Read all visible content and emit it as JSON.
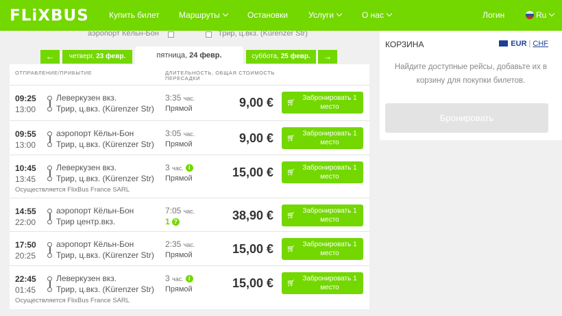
{
  "header": {
    "logo": "FLiXBUS",
    "nav": [
      "Купить билет",
      "Маршруты",
      "Остановки",
      "Услуги",
      "О нас"
    ],
    "login": "Логин",
    "language": "Ru"
  },
  "stations_strip": [
    "аэропорт Кёльн-Бон",
    "Трир, ц.вкз. (Kürenzer Str)"
  ],
  "dates": {
    "prev_label": "четверг,",
    "prev_date": "23 февр.",
    "active_label": "пятница,",
    "active_date": "24 февр.",
    "next_label": "суббота,",
    "next_date": "25 февр.",
    "prev_arrow": "←",
    "next_arrow": "→"
  },
  "columns": {
    "departure": "ОТПРАВЛЕНИЕ/ПРИБЫТИЕ",
    "duration": "ДЛИТЕЛЬНОСТЬ, ОБЩАЯ СТОИМОСТЬ",
    "duration2": "ПЕРЕСАДКИ"
  },
  "rides": [
    {
      "dep": "09:25",
      "arr": "13:00",
      "from": "Леверкузен вкз.",
      "to": "Трир, ц.вкз. (Kürenzer Str)",
      "dur": "3:35",
      "unit": "час.",
      "transfer": "Прямой",
      "price": "9,00 €",
      "button": "Забронировать 1 место",
      "info": false,
      "operator": ""
    },
    {
      "dep": "09:55",
      "arr": "13:00",
      "from": "аэропорт Кёльн-Бон",
      "to": "Трир, ц.вкз. (Kürenzer Str)",
      "dur": "3:05",
      "unit": "час.",
      "transfer": "Прямой",
      "price": "9,00 €",
      "button": "Забронировать 1 место",
      "info": false,
      "operator": ""
    },
    {
      "dep": "10:45",
      "arr": "13:45",
      "from": "Леверкузен вкз.",
      "to": "Трир, ц.вкз. (Kürenzer Str)",
      "dur": "3",
      "unit": "час.",
      "transfer": "Прямой",
      "price": "15,00 €",
      "button": "Забронировать 1 место",
      "info": true,
      "operator": "Осуществляется FlixBus France SARL"
    },
    {
      "dep": "14:55",
      "arr": "22:00",
      "from": "аэропорт Кёльн-Бон",
      "to": "Трир центр.вкз.",
      "dur": "7:05",
      "unit": "час.",
      "transfer": "1",
      "price": "38,90 €",
      "button": "Забронировать 1 место",
      "info": false,
      "operator": ""
    },
    {
      "dep": "17:50",
      "arr": "20:25",
      "from": "аэропорт Кёльн-Бон",
      "to": "Трир, ц.вкз. (Kürenzer Str)",
      "dur": "2:35",
      "unit": "час.",
      "transfer": "Прямой",
      "price": "15,00 €",
      "button": "Забронировать 1 место",
      "info": false,
      "operator": ""
    },
    {
      "dep": "22:45",
      "arr": "01:45",
      "from": "Леверкузен вкз.",
      "to": "Трир, ц.вкз. (Kürenzer Str)",
      "dur": "3",
      "unit": "час.",
      "transfer": "Прямой",
      "price": "15,00 €",
      "button": "Забронировать 1 место",
      "info": true,
      "operator": "Осуществляется FlixBus France SARL"
    }
  ],
  "basket": {
    "title": "КОРЗИНА",
    "currency_active": "EUR",
    "currency_other": "CHF",
    "separator": "|",
    "text": "Найдите доступные рейсы, добавьте их в корзину для покупки билетов.",
    "button": "Бронировать"
  }
}
